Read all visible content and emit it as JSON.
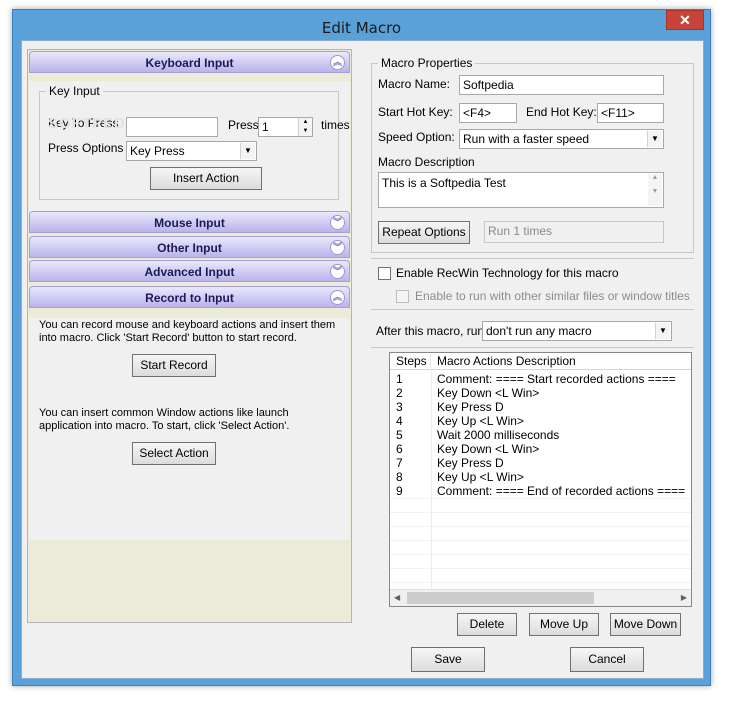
{
  "window": {
    "title": "Edit Macro",
    "close_glyph": "✕"
  },
  "left": {
    "keyboard_header": "Keyboard Input",
    "key_input_group": "Key Input",
    "key_to_press_label": "Key To Press",
    "key_to_press_value": "",
    "press_label": "Press",
    "press_value": "1",
    "times_label": "times",
    "press_options_label": "Press Options",
    "press_options_value": "Key Press",
    "insert_action_button": "Insert Action",
    "mouse_header": "Mouse Input",
    "other_header": "Other Input",
    "advanced_header": "Advanced Input",
    "record_header": "Record to Input",
    "record_text": "You can record mouse and keyboard actions and insert them into macro. Click 'Start Record' button to start record.",
    "start_record_button": "Start Record",
    "select_text": "You can insert common Window actions like launch application into macro. To start, click 'Select Action'.",
    "select_action_button": "Select Action",
    "watermark": "SOFTPEDIA"
  },
  "right": {
    "macro_properties_group": "Macro Properties",
    "macro_name_label": "Macro Name:",
    "macro_name_value": "Softpedia",
    "start_hotkey_label": "Start Hot Key:",
    "start_hotkey_value": "<F4>",
    "end_hotkey_label": "End Hot Key:",
    "end_hotkey_value": "<F11>",
    "speed_option_label": "Speed Option:",
    "speed_option_value": "Run with a faster speed",
    "macro_description_label": "Macro Description",
    "macro_description_value": "This is a Softpedia Test",
    "repeat_options_button": "Repeat Options",
    "repeat_value": "Run 1 times",
    "enable_recwin_label": "Enable RecWin Technology for this macro",
    "enable_similar_label": "Enable to run with other similar files or window titles",
    "after_macro_label": "After this macro, run",
    "after_macro_value": "don't run any macro"
  },
  "table": {
    "headers": [
      "Steps",
      "Macro Actions Description"
    ],
    "rows": [
      {
        "step": "1",
        "desc": "Comment: ==== Start recorded actions ===="
      },
      {
        "step": "2",
        "desc": "Key Down <L Win>"
      },
      {
        "step": "3",
        "desc": "Key Press D"
      },
      {
        "step": "4",
        "desc": "Key Up <L Win>"
      },
      {
        "step": "5",
        "desc": "Wait 2000 milliseconds"
      },
      {
        "step": "6",
        "desc": "Key Down <L Win>"
      },
      {
        "step": "7",
        "desc": "Key Press D"
      },
      {
        "step": "8",
        "desc": "Key Up <L Win>"
      },
      {
        "step": "9",
        "desc": "Comment: ==== End of recorded actions ===="
      }
    ]
  },
  "buttons": {
    "delete": "Delete",
    "move_up": "Move Up",
    "move_down": "Move Down",
    "save": "Save",
    "cancel": "Cancel"
  },
  "icons": {
    "expand": "chevron-up-icon",
    "collapse": "chevron-down-icon"
  },
  "colors": {
    "accordion_top": "#eae8fb",
    "accordion_bottom": "#b9b3eb",
    "window_frame": "#5ba1d9",
    "close_button": "#c7443a"
  }
}
